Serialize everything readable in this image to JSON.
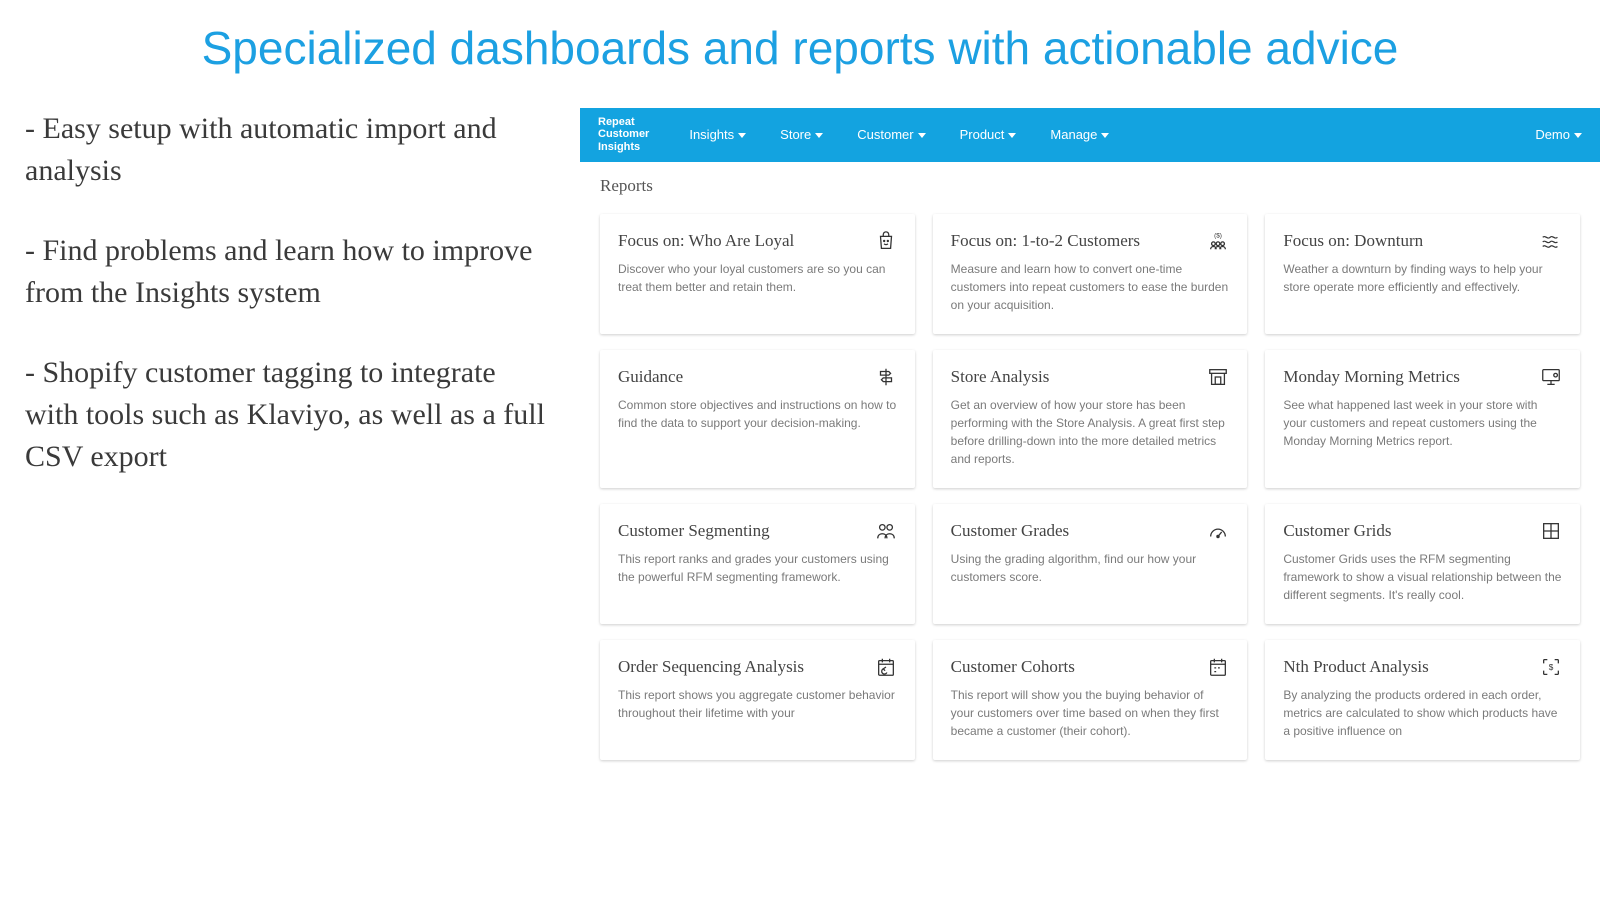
{
  "headline": "Specialized dashboards and reports with actionable advice",
  "bullets": [
    "- Easy setup with automatic import and analysis",
    "- Find problems and learn how to improve from the Insights system",
    "- Shopify customer tagging to integrate with tools such as Klaviyo, as well as a full CSV export"
  ],
  "nav": {
    "brand": "Repeat\nCustomer\nInsights",
    "items": [
      "Insights",
      "Store",
      "Customer",
      "Product",
      "Manage"
    ],
    "right": "Demo"
  },
  "reports_title": "Reports",
  "cards": [
    {
      "title": "Focus on: Who Are Loyal",
      "desc": "Discover who your loyal customers are so you can treat them better and retain them.",
      "icon": "bag"
    },
    {
      "title": "Focus on: 1-to-2 Customers",
      "desc": "Measure and learn how to convert one-time customers into repeat customers to ease the burden on your acquisition.",
      "icon": "people-money"
    },
    {
      "title": "Focus on: Downturn",
      "desc": "Weather a downturn by finding ways to help your store operate more efficiently and effectively.",
      "icon": "waves"
    },
    {
      "title": "Guidance",
      "desc": "Common store objectives and instructions on how to find the data to support your decision-making.",
      "icon": "signpost"
    },
    {
      "title": "Store Analysis",
      "desc": "Get an overview of how your store has been performing with the Store Analysis. A great first step before drilling-down into the more detailed metrics and reports.",
      "icon": "storefront"
    },
    {
      "title": "Monday Morning Metrics",
      "desc": "See what happened last week in your store with your customers and repeat customers using the Monday Morning Metrics report.",
      "icon": "monitor"
    },
    {
      "title": "Customer Segmenting",
      "desc": "This report ranks and grades your customers using the powerful RFM segmenting framework.",
      "icon": "group"
    },
    {
      "title": "Customer Grades",
      "desc": "Using the grading algorithm, find our how your customers score.",
      "icon": "dial"
    },
    {
      "title": "Customer Grids",
      "desc": "Customer Grids uses the RFM segmenting framework to show a visual relationship between the different segments. It's really cool.",
      "icon": "grid"
    },
    {
      "title": "Order Sequencing Analysis",
      "desc": "This report shows you aggregate customer behavior throughout their lifetime with your",
      "icon": "calendar-cycle"
    },
    {
      "title": "Customer Cohorts",
      "desc": "This report will show you the buying behavior of your customers over time based on when they first became a customer (their cohort).",
      "icon": "calendar"
    },
    {
      "title": "Nth Product Analysis",
      "desc": "By analyzing the products ordered in each order, metrics are calculated to show which products have a positive influence on",
      "icon": "scan-money"
    }
  ]
}
